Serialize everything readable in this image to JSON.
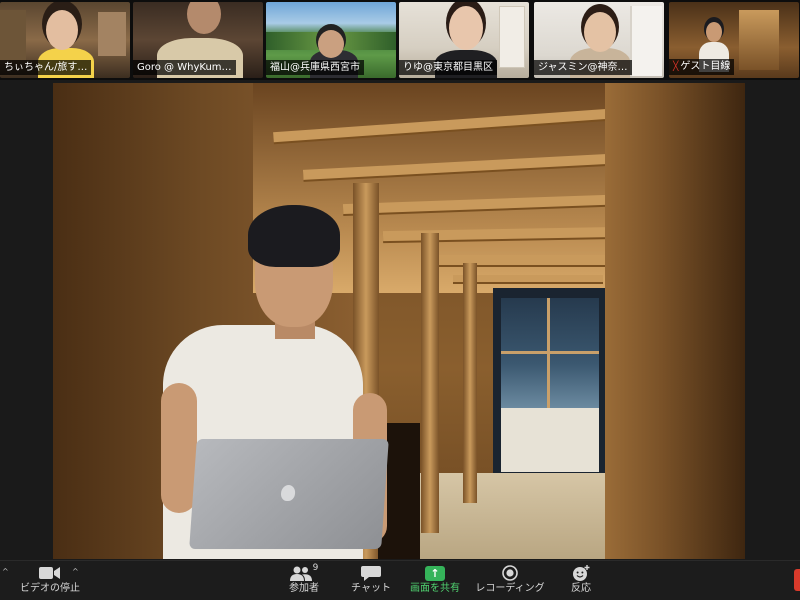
{
  "participants": [
    {
      "name": "ちぃちゃん/旅す…",
      "muted": false
    },
    {
      "name": "Goro @ WhyKum…",
      "muted": false
    },
    {
      "name": "福山@兵庫県西宮市",
      "muted": false
    },
    {
      "name": "りゆ@東京都目黒区",
      "muted": false
    },
    {
      "name": "ジャスミン@神奈…",
      "muted": false
    },
    {
      "name": "ゲスト目線",
      "muted": true
    }
  ],
  "toolbar": {
    "left_caret": "^",
    "video": {
      "label": "ビデオの停止",
      "icon": "video-camera-icon"
    },
    "participants": {
      "label": "参加者",
      "count": "9",
      "icon": "participants-icon"
    },
    "chat": {
      "label": "チャット",
      "icon": "chat-icon"
    },
    "share": {
      "label": "画面を共有",
      "icon": "share-screen-icon",
      "glyph": "↑"
    },
    "record": {
      "label": "レコーディング",
      "icon": "record-icon"
    },
    "reactions": {
      "label": "反応",
      "icon": "reaction-emoji-icon"
    }
  },
  "colors": {
    "toolbar_bg": "#1c1c1c",
    "share_accent": "#35b35a",
    "end_button": "#d93a2b",
    "muted_icon": "#e0352b"
  }
}
